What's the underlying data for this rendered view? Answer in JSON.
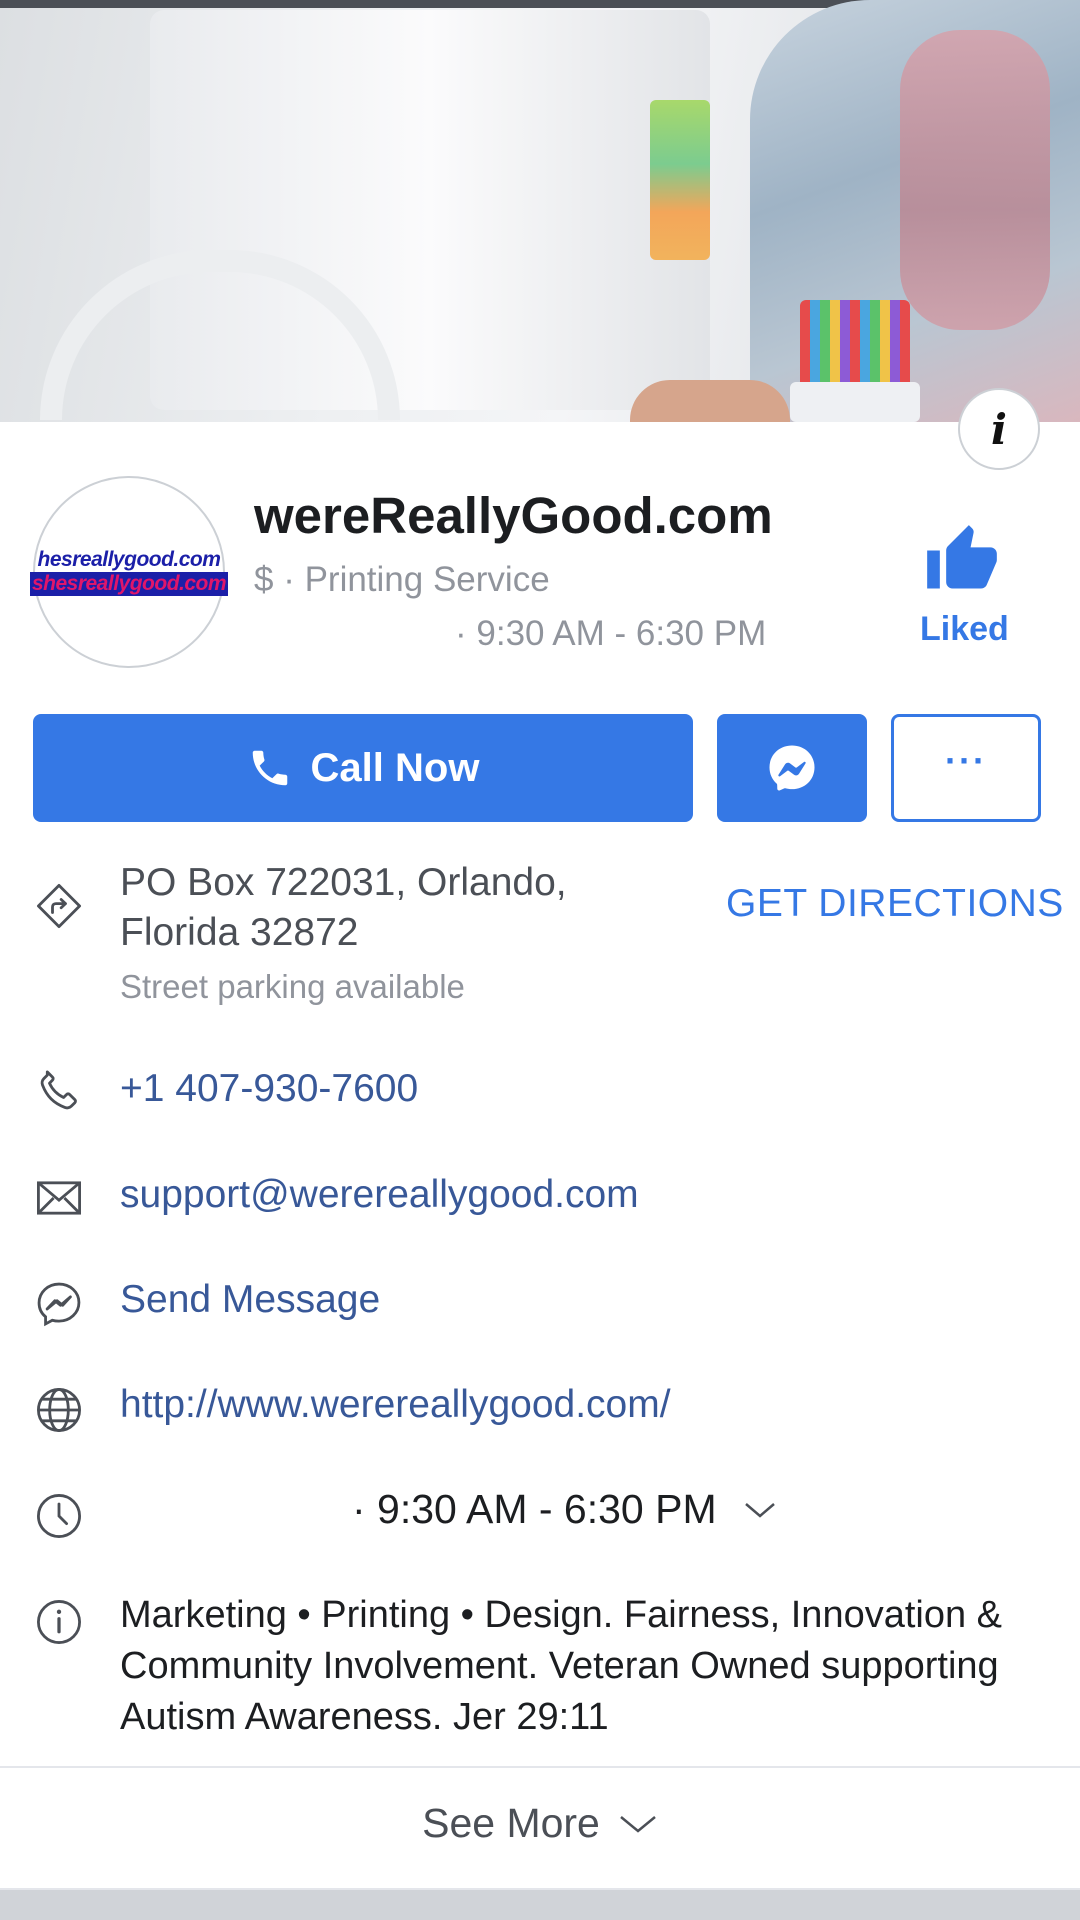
{
  "page": {
    "name": "wereReallyGood.com",
    "avatar_line1": "hesreallygood.com",
    "avatar_line2": "shesreallygood.com",
    "category": "$ · Printing Service",
    "hours_summary": "· 9:30 AM - 6:30 PM",
    "like_state": "Liked"
  },
  "actions": {
    "call_label": "Call Now",
    "more_label": "···"
  },
  "details": {
    "address_line1": "PO Box 722031, Orlando,",
    "address_line2": "Florida 32872",
    "parking": "Street parking available",
    "directions_label": "GET DIRECTIONS",
    "phone": "+1 407-930-7600",
    "email": "support@werereallygood.com",
    "message_label": "Send Message",
    "website": "http://www.werereallygood.com/",
    "hours": "· 9:30 AM - 6:30 PM",
    "about": "Marketing • Printing • Design. Fairness, Innovation & Community Involvement. Veteran Owned supporting Autism Awareness. Jer 29:11"
  },
  "footer": {
    "see_more_label": "See More"
  },
  "colors": {
    "brand_blue": "#3578e5",
    "link_blue": "#385898",
    "secondary_text": "#90949c"
  },
  "icons": [
    "info-icon",
    "thumbs-up-icon",
    "phone-icon",
    "messenger-icon",
    "directions-icon",
    "mail-icon",
    "globe-icon",
    "clock-icon",
    "chevron-down-icon"
  ]
}
